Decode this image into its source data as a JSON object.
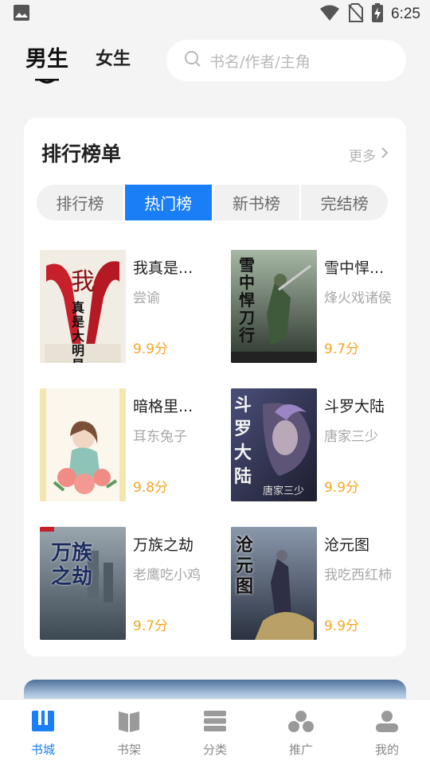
{
  "status_bar": {
    "time": "6:25",
    "icons": [
      "image-icon",
      "wifi-icon",
      "no-sim-icon",
      "battery-charging-icon"
    ]
  },
  "header": {
    "tabs": [
      {
        "label": "男生",
        "active": true
      },
      {
        "label": "女生",
        "active": false
      }
    ],
    "search": {
      "placeholder": "书名/作者/主角",
      "icon": "search-icon"
    }
  },
  "ranking": {
    "title": "排行榜单",
    "more_label": "更多",
    "tabs": [
      {
        "label": "排行榜",
        "active": false
      },
      {
        "label": "热门榜",
        "active": true
      },
      {
        "label": "新书榜",
        "active": false
      },
      {
        "label": "完结榜",
        "active": false
      }
    ],
    "books": [
      {
        "title": "我真是...",
        "author": "尝谕",
        "score": "9.9分",
        "cover_text": [
          "我",
          "真是大明星"
        ]
      },
      {
        "title": "雪中悍...",
        "author": "烽火戏诸侯",
        "score": "9.7分",
        "cover_text": [
          "雪中悍刀行"
        ]
      },
      {
        "title": "暗格里...",
        "author": "耳东兔子",
        "score": "9.8分",
        "cover_text": []
      },
      {
        "title": "斗罗大陆",
        "author": "唐家三少",
        "score": "9.9分",
        "cover_text": [
          "斗罗大陆",
          "唐家三少"
        ]
      },
      {
        "title": "万族之劫",
        "author": "老鹰吃小鸡",
        "score": "9.7分",
        "cover_text": [
          "万族之劫"
        ]
      },
      {
        "title": "沧元图",
        "author": "我吃西红柿",
        "score": "9.9分",
        "cover_text": [
          "沧元图"
        ]
      }
    ]
  },
  "bottom_nav": [
    {
      "label": "书城",
      "icon": "bookstore-icon",
      "active": true
    },
    {
      "label": "书架",
      "icon": "bookshelf-icon",
      "active": false
    },
    {
      "label": "分类",
      "icon": "category-icon",
      "active": false
    },
    {
      "label": "推广",
      "icon": "promote-icon",
      "active": false
    },
    {
      "label": "我的",
      "icon": "profile-icon",
      "active": false
    }
  ],
  "colors": {
    "accent": "#1a7ef6",
    "score": "#f5a623",
    "background": "#f4f4f4"
  }
}
